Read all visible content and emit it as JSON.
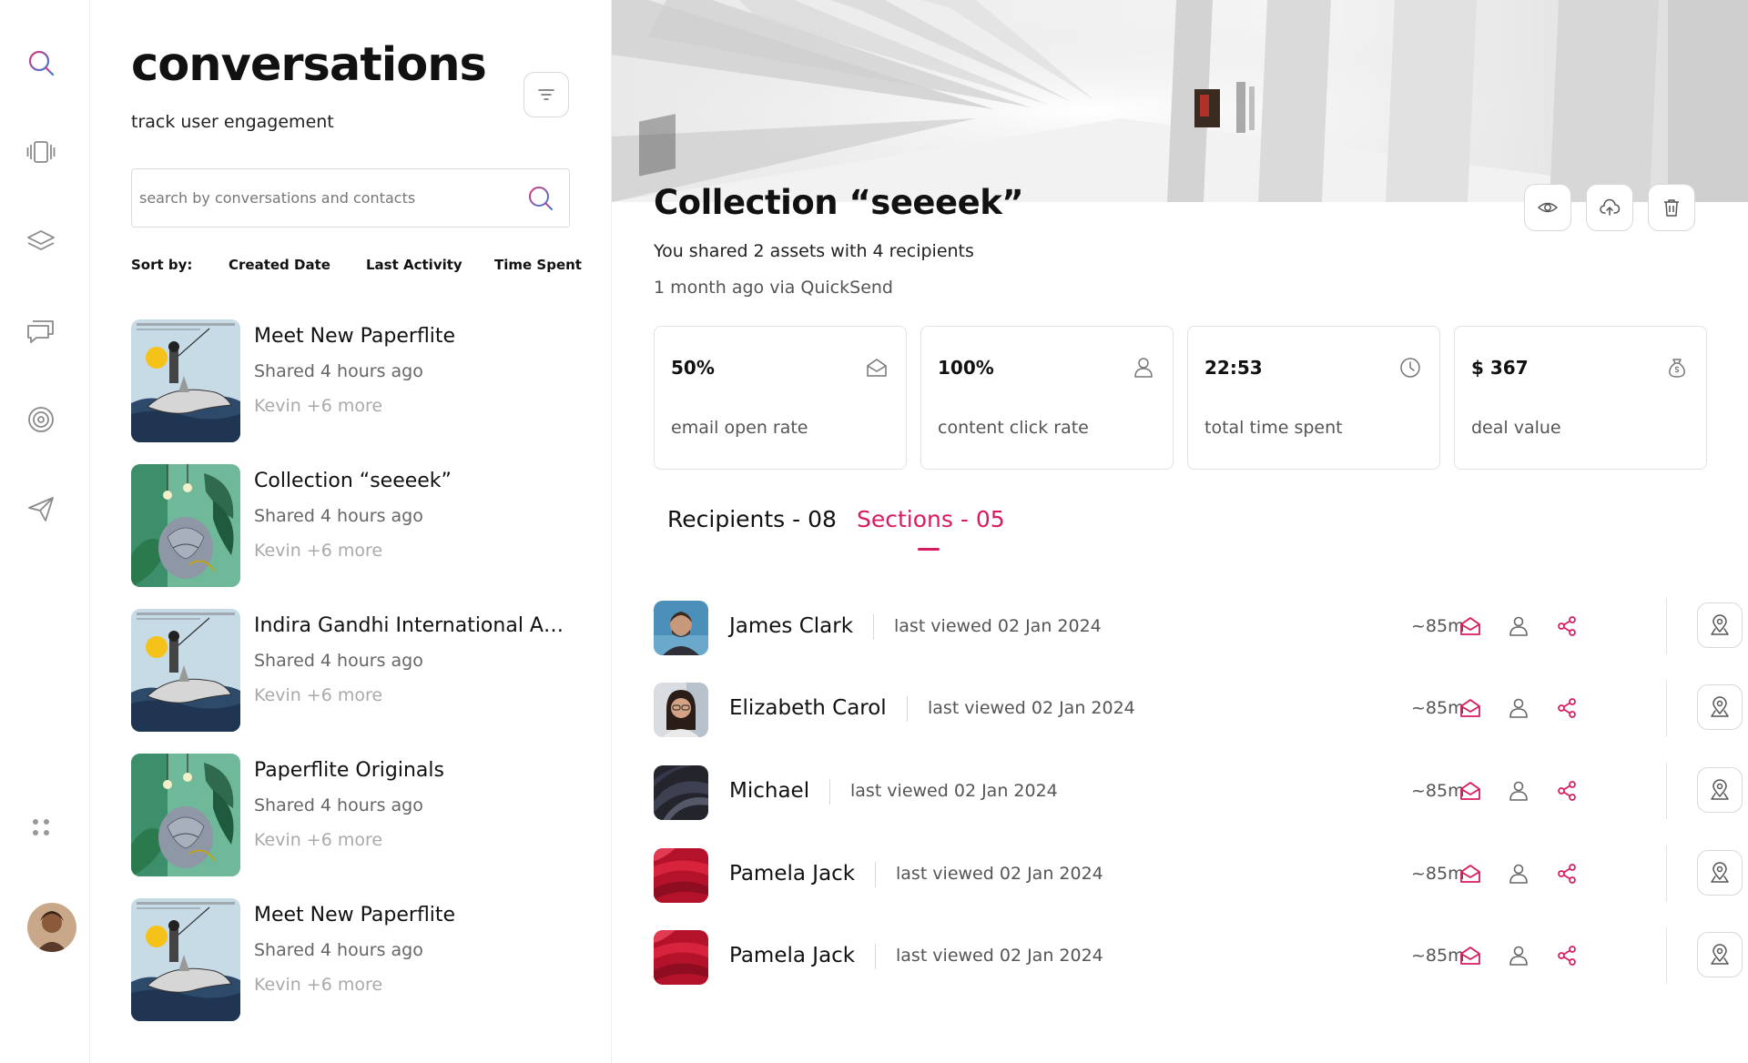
{
  "nav": {
    "icons": [
      "search-icon",
      "slides-icon",
      "layers-icon",
      "chat-icon",
      "target-icon",
      "send-icon",
      "apps-icon"
    ],
    "accent": "#d81b60"
  },
  "list": {
    "title": "conversations",
    "subtitle": "track user engagement",
    "search_placeholder": "search by conversations and contacts",
    "sort_label": "Sort by:",
    "sort_options": [
      "Created Date",
      "Last Activity",
      "Time Spent"
    ],
    "items": [
      {
        "title": "Meet New Paperflite",
        "meta": "Shared 4 hours ago",
        "people": "Kevin +6 more",
        "thumb": "shark"
      },
      {
        "title": "Collection “seeeek”",
        "meta": "Shared 4 hours ago",
        "people": "Kevin +6 more",
        "thumb": "jungle"
      },
      {
        "title": "Indira Gandhi International Ai...",
        "meta": "Shared 4 hours ago",
        "people": "Kevin +6 more",
        "thumb": "shark"
      },
      {
        "title": "Paperflite Originals",
        "meta": "Shared 4 hours ago",
        "people": "Kevin +6 more",
        "thumb": "jungle"
      },
      {
        "title": "Meet New Paperflite",
        "meta": "Shared 4 hours ago",
        "people": "Kevin +6 more",
        "thumb": "shark"
      }
    ]
  },
  "detail": {
    "title": "Collection “seeeek”",
    "shared_text": "You shared 2 assets with 4 recipients",
    "time_text": "1 month ago via QuickSend",
    "stats": [
      {
        "value": "50%",
        "label": "email open rate",
        "icon": "mail-open-icon"
      },
      {
        "value": "100%",
        "label": "content click rate",
        "icon": "user-icon"
      },
      {
        "value": "22:53",
        "label": "total time spent",
        "icon": "clock-icon"
      },
      {
        "value": "$ 367",
        "label": "deal value",
        "icon": "money-bag-icon"
      }
    ],
    "tabs": {
      "recipients": "Recipients - 08",
      "sections": "Sections - 05"
    },
    "recipients": [
      {
        "name": "James Clark",
        "viewed": "last viewed 02 Jan 2024",
        "duration": "~85m",
        "avatar": "man"
      },
      {
        "name": "Elizabeth Carol",
        "viewed": "last viewed 02 Jan 2024",
        "duration": "~85m",
        "avatar": "woman"
      },
      {
        "name": "Michael",
        "viewed": "last viewed 02 Jan 2024",
        "duration": "~85m",
        "avatar": "dark"
      },
      {
        "name": "Pamela Jack",
        "viewed": "last viewed 02 Jan 2024",
        "duration": "~85m",
        "avatar": "red"
      },
      {
        "name": "Pamela Jack",
        "viewed": "last viewed 02 Jan 2024",
        "duration": "~85m",
        "avatar": "red"
      }
    ]
  }
}
